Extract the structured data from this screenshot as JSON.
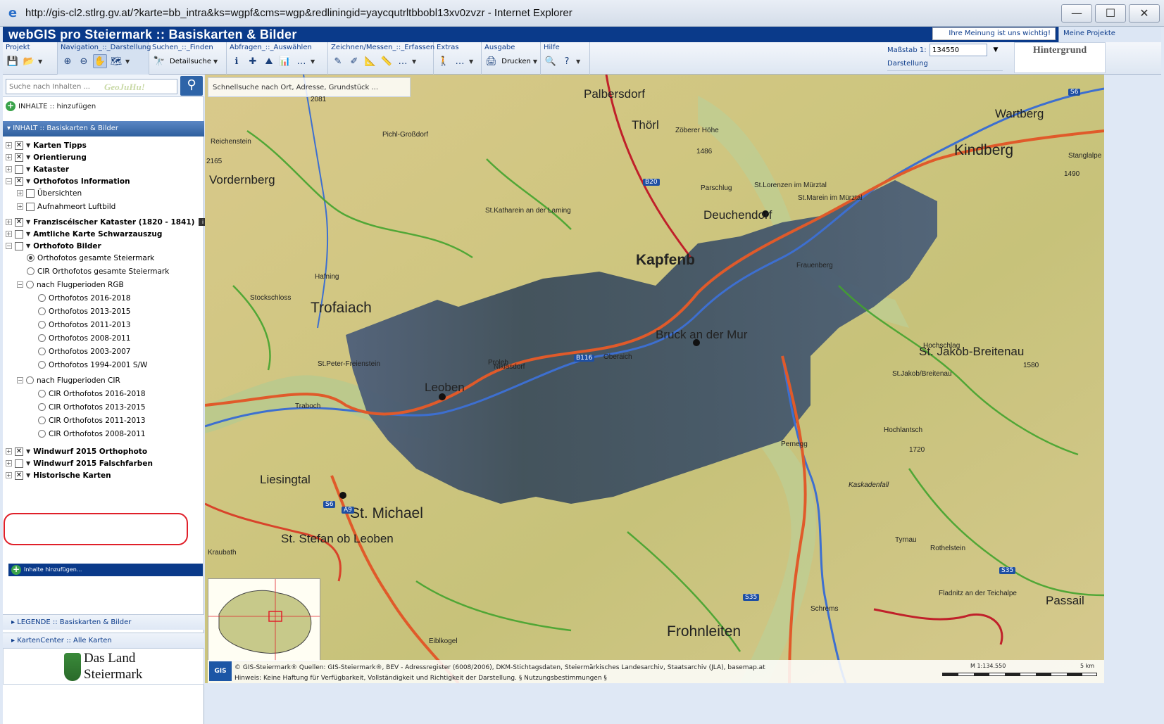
{
  "window": {
    "url_title": "http://gis-cl2.stlrg.gv.at/?karte=bb_intra&ks=wgpf&cms=wgp&redliningid=yaycqutrltbbobl13xv0zvzr - Internet Explorer",
    "minimize": "—",
    "maximize": "☐",
    "close": "✕"
  },
  "app": {
    "title": "webGIS pro Steiermark ::  Basiskarten & Bilder",
    "opinion": "Ihre Meinung ist uns wichtig!",
    "projects": "Meine Projekte"
  },
  "toolbar": {
    "groups": [
      {
        "label": "Projekt"
      },
      {
        "label": "Navigation_::_Darstellung"
      },
      {
        "label": "Suchen_::_Finden",
        "button": "Detailsuche"
      },
      {
        "label": "Abfragen_::_Auswählen"
      },
      {
        "label": "Zeichnen/Messen_::_Erfassen"
      },
      {
        "label": "Extras"
      },
      {
        "label": "Ausgabe",
        "button": "Drucken"
      },
      {
        "label": "Hilfe"
      }
    ],
    "scale_label": "Maßstab  1:",
    "scale_value": "134550",
    "darstellung": "Darstellung",
    "hintergrund": "Hintergrund"
  },
  "sidebar": {
    "search_placeholder": "Suche nach Inhalten ...",
    "geojuhu": "GeoJuHu!",
    "add_content": "INHALTE :: hinzufügen",
    "section_title": "INHALT :: Basiskarten & Bilder",
    "tree": [
      {
        "label": "Karten Tipps",
        "bold": true,
        "checked": true,
        "exp": "+"
      },
      {
        "label": "Orientierung",
        "bold": true,
        "checked": true,
        "exp": "+"
      },
      {
        "label": "Kataster",
        "bold": true,
        "checked": false,
        "exp": "+"
      },
      {
        "label": "Orthofotos Information",
        "bold": true,
        "checked": true,
        "exp": "−"
      },
      {
        "label": "Übersichten",
        "bold": false,
        "checked": false,
        "exp": "+"
      },
      {
        "label": "Aufnahmeort Luftbild",
        "bold": false,
        "checked": false,
        "exp": "+"
      },
      {
        "label": "Franziscéischer Kataster (1820 - 1841)",
        "bold": true,
        "checked": true,
        "exp": "+"
      },
      {
        "label": "Amtliche Karte Schwarzauszug",
        "bold": true,
        "checked": false,
        "exp": "+"
      },
      {
        "label": "Orthofoto Bilder",
        "bold": true,
        "checked": false,
        "exp": "−"
      },
      {
        "label": "Orthofotos gesamte Steiermark",
        "radio": true,
        "on": true
      },
      {
        "label": "CIR Orthofotos gesamte Steiermark",
        "radio": true
      },
      {
        "label": "nach Flugperioden RGB",
        "radio": true,
        "exp": "−"
      },
      {
        "label": "Orthofotos 2016-2018",
        "radio": true
      },
      {
        "label": "Orthofotos 2013-2015",
        "radio": true
      },
      {
        "label": "Orthofotos 2011-2013",
        "radio": true
      },
      {
        "label": "Orthofotos 2008-2011",
        "radio": true
      },
      {
        "label": "Orthofotos 2003-2007",
        "radio": true
      },
      {
        "label": "Orthofotos 1994-2001 S/W",
        "radio": true
      },
      {
        "label": "nach Flugperioden CIR",
        "radio": true,
        "exp": "−"
      },
      {
        "label": "CIR Orthofotos 2016-2018",
        "radio": true
      },
      {
        "label": "CIR Orthofotos 2013-2015",
        "radio": true
      },
      {
        "label": "CIR Orthofotos 2011-2013",
        "radio": true
      },
      {
        "label": "CIR Orthofotos 2008-2011",
        "radio": true
      },
      {
        "label": "Windwurf 2015 Orthophoto",
        "bold": true,
        "checked": true,
        "exp": "+"
      },
      {
        "label": "Windwurf 2015 Falschfarben",
        "bold": true,
        "checked": false,
        "exp": "+"
      },
      {
        "label": "Historische Karten",
        "bold": true,
        "checked": true,
        "exp": "+"
      }
    ],
    "add_bar": "Inhalte hinzufügen...",
    "legend": "LEGENDE :: Basiskarten & Bilder",
    "kartencenter": "KartenCenter :: Alle Karten",
    "land_line1": "Das Land",
    "land_line2": "Steiermark"
  },
  "map": {
    "quicksearch_placeholder": "Schnellsuche nach Ort, Adresse, Grundstück ...",
    "labels": [
      {
        "t": "Kapfenb",
        "cls": "ml-big ml-bold"
      },
      {
        "t": "Trofaiach",
        "cls": "ml-big"
      },
      {
        "t": "Bruck an der Mur",
        "cls": "ml-mid"
      },
      {
        "t": "Leoben",
        "cls": "ml-mid"
      },
      {
        "t": "St. Michael",
        "cls": "ml-big"
      },
      {
        "t": "Frohnleiten",
        "cls": "ml-big"
      },
      {
        "t": "Kindberg",
        "cls": "ml-big"
      },
      {
        "t": "Deuchendorf",
        "cls": "ml-mid"
      },
      {
        "t": "Thörl",
        "cls": "ml-mid"
      },
      {
        "t": "Palbersdorf",
        "cls": "ml-mid"
      },
      {
        "t": "Vordernberg",
        "cls": "ml-mid"
      },
      {
        "t": "St. Jakob-Breitenau",
        "cls": "ml-mid"
      },
      {
        "t": "Hochschlag",
        "cls": "ml-small"
      },
      {
        "t": "1580",
        "cls": "ml-small"
      },
      {
        "t": "Wartberg",
        "cls": "ml-mid"
      },
      {
        "t": "Zöberer Höhe",
        "cls": "ml-small"
      },
      {
        "t": "1486",
        "cls": "ml-small"
      },
      {
        "t": "Liesingtal",
        "cls": "ml-mid"
      },
      {
        "t": "St. Stefan ob Leoben",
        "cls": "ml-mid"
      },
      {
        "t": "Passail",
        "cls": "ml-mid"
      },
      {
        "t": "Kaskadenfall",
        "cls": "ml-small ml-italic"
      },
      {
        "t": "Hochlantsch",
        "cls": "ml-small"
      },
      {
        "t": "1720",
        "cls": "ml-small"
      },
      {
        "t": "Oberaich",
        "cls": "ml-small"
      },
      {
        "t": "Niklasdorf",
        "cls": "ml-small"
      },
      {
        "t": "Proleb",
        "cls": "ml-small"
      },
      {
        "t": "Frauenberg",
        "cls": "ml-small"
      },
      {
        "t": "Pernegg",
        "cls": "ml-small"
      },
      {
        "t": "Rothelstein",
        "cls": "ml-small"
      },
      {
        "t": "Schrems",
        "cls": "ml-small"
      },
      {
        "t": "Eiblkogel",
        "cls": "ml-small"
      },
      {
        "t": "St.Peter-Freienstein",
        "cls": "ml-small"
      },
      {
        "t": "St.Katharein an der Laming",
        "cls": "ml-small"
      },
      {
        "t": "St.Marein im Mürztal",
        "cls": "ml-small"
      },
      {
        "t": "St.Lorenzen im Mürztal",
        "cls": "ml-small"
      },
      {
        "t": "Stockschloss",
        "cls": "ml-small"
      },
      {
        "t": "Hafning",
        "cls": "ml-small"
      },
      {
        "t": "Traboch",
        "cls": "ml-small"
      },
      {
        "t": "Kraubath",
        "cls": "ml-small"
      },
      {
        "t": "Tyrnau",
        "cls": "ml-small"
      },
      {
        "t": "Fladnitz an der Teichalpe",
        "cls": "ml-small"
      },
      {
        "t": "Stanglalpe",
        "cls": "ml-small"
      },
      {
        "t": "1490",
        "cls": "ml-small"
      },
      {
        "t": "Reichenstein",
        "cls": "ml-small"
      },
      {
        "t": "2165",
        "cls": "ml-small"
      },
      {
        "t": "2081",
        "cls": "ml-small"
      },
      {
        "t": "Pichl-Großdorf",
        "cls": "ml-small"
      },
      {
        "t": "Parschlug",
        "cls": "ml-small"
      },
      {
        "t": "St.Jakob/Breitenau",
        "cls": "ml-small"
      }
    ],
    "shields": [
      "S6",
      "S35",
      "A9",
      "S6",
      "B20",
      "B116",
      "S35"
    ],
    "attribution_line1": "© GIS-Steiermark®  Quellen: GIS-Steiermark®, BEV - Adressregister (6008/2006), DKM-Stichtagsdaten, Steiermärkisches Landesarchiv, Staatsarchiv (JLA), basemap.at",
    "attribution_line2": "Hinweis: Keine Haftung für Verfügbarkeit, Vollständigkeit und Richtigkeit der Darstellung. § Nutzungsbestimmungen §",
    "gis_logo": "GIS",
    "scale_text": "M 1:134.550",
    "scale_km": "5 km"
  }
}
